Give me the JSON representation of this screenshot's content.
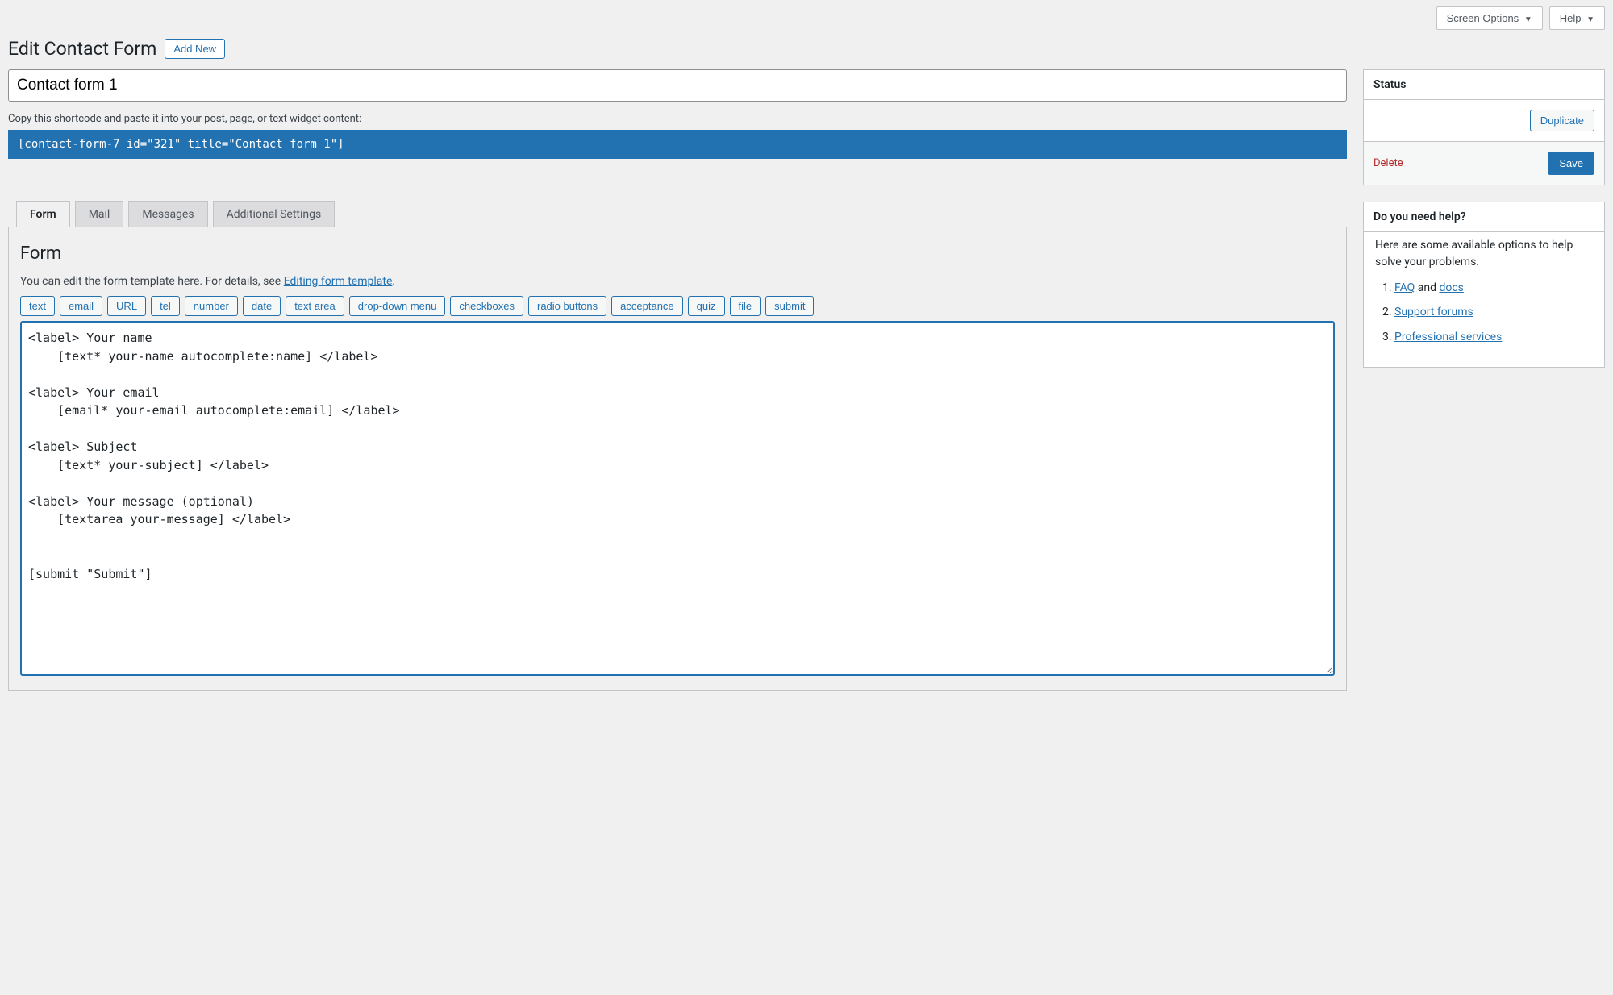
{
  "topButtons": {
    "screenOptions": "Screen Options",
    "help": "Help"
  },
  "header": {
    "title": "Edit Contact Form",
    "addNew": "Add New"
  },
  "form": {
    "titleValue": "Contact form 1",
    "shortcodeHelp": "Copy this shortcode and paste it into your post, page, or text widget content:",
    "shortcode": "[contact-form-7 id=\"321\" title=\"Contact form 1\"]"
  },
  "tabs": [
    "Form",
    "Mail",
    "Messages",
    "Additional Settings"
  ],
  "formPanel": {
    "heading": "Form",
    "descPrefix": "You can edit the form template here. For details, see ",
    "descLink": "Editing form template",
    "descSuffix": ".",
    "tagButtons": [
      "text",
      "email",
      "URL",
      "tel",
      "number",
      "date",
      "text area",
      "drop-down menu",
      "checkboxes",
      "radio buttons",
      "acceptance",
      "quiz",
      "file",
      "submit"
    ],
    "template": "<label> Your name\n    [text* your-name autocomplete:name] </label>\n\n<label> Your email\n    [email* your-email autocomplete:email] </label>\n\n<label> Subject\n    [text* your-subject] </label>\n\n<label> Your message (optional)\n    [textarea your-message] </label>\n\n\n[submit \"Submit\"]"
  },
  "statusBox": {
    "title": "Status",
    "duplicate": "Duplicate",
    "delete": "Delete",
    "save": "Save"
  },
  "helpBox": {
    "title": "Do you need help?",
    "intro": "Here are some available options to help solve your problems.",
    "faq": "FAQ",
    "and": " and ",
    "docs": "docs",
    "support": "Support forums",
    "professional": "Professional services"
  }
}
